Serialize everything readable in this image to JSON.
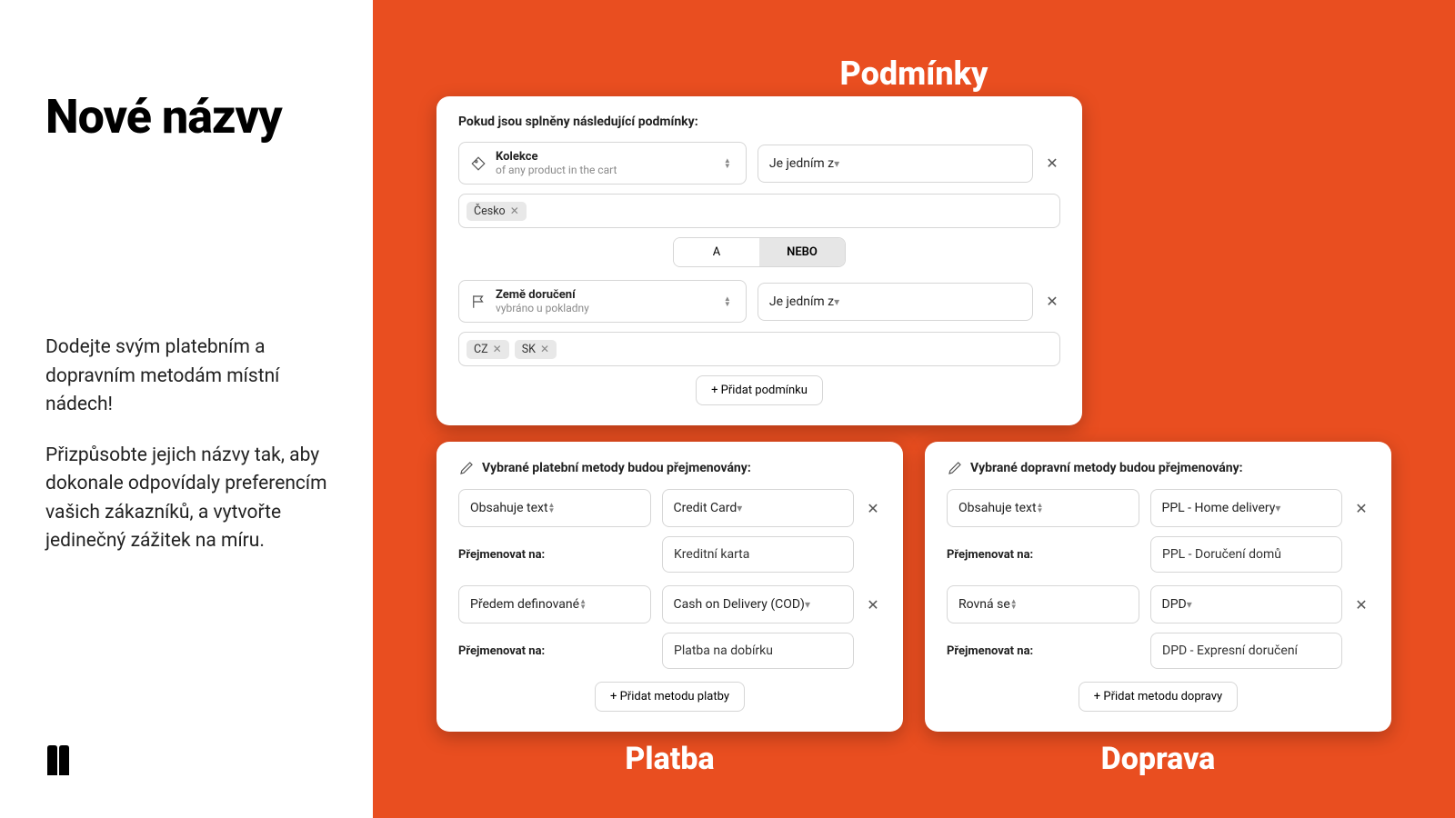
{
  "left": {
    "title": "Nové názvy",
    "para1": "Dodejte svým platebním a dopravním metodám místní nádech!",
    "para2": "Přizpůsobte jejich názvy tak, aby dokonale odpovídaly preferencím vašich zákazníků, a vytvořte jedinečný zážitek na míru."
  },
  "conditions": {
    "heading": "Podmínky",
    "label": "Pokud jsou splněny následující podmínky:",
    "group1": {
      "field_title": "Kolekce",
      "field_sub": "of any product in the cart",
      "operator": "Je jedním z",
      "tags": [
        "Česko"
      ]
    },
    "toggle": {
      "opt_a": "A",
      "opt_b": "NEBO"
    },
    "group2": {
      "field_title": "Země doručení",
      "field_sub": "vybráno u pokladny",
      "operator": "Je jedním z",
      "tags": [
        "CZ",
        "SK"
      ]
    },
    "add_button": "+ Přidat podmínku"
  },
  "payment": {
    "heading": "Platba",
    "label": "Vybrané platební metody budou přejmenovány:",
    "rename_label": "Přejmenovat na:",
    "rows": [
      {
        "match_type": "Obsahuje text",
        "method": "Credit Card",
        "rename_to": "Kreditní karta"
      },
      {
        "match_type": "Předem definované",
        "method": "Cash on Delivery (COD)",
        "rename_to": "Platba na dobírku"
      }
    ],
    "add_button": "+ Přidat metodu platby"
  },
  "shipping": {
    "heading": "Doprava",
    "label": "Vybrané dopravní metody budou přejmenovány:",
    "rename_label": "Přejmenovat na:",
    "rows": [
      {
        "match_type": "Obsahuje text",
        "method": "PPL - Home delivery",
        "rename_to": "PPL - Doručení domů"
      },
      {
        "match_type": "Rovná se",
        "method": "DPD",
        "rename_to": "DPD - Expresní doručení"
      }
    ],
    "add_button": "+ Přidat metodu dopravy"
  }
}
